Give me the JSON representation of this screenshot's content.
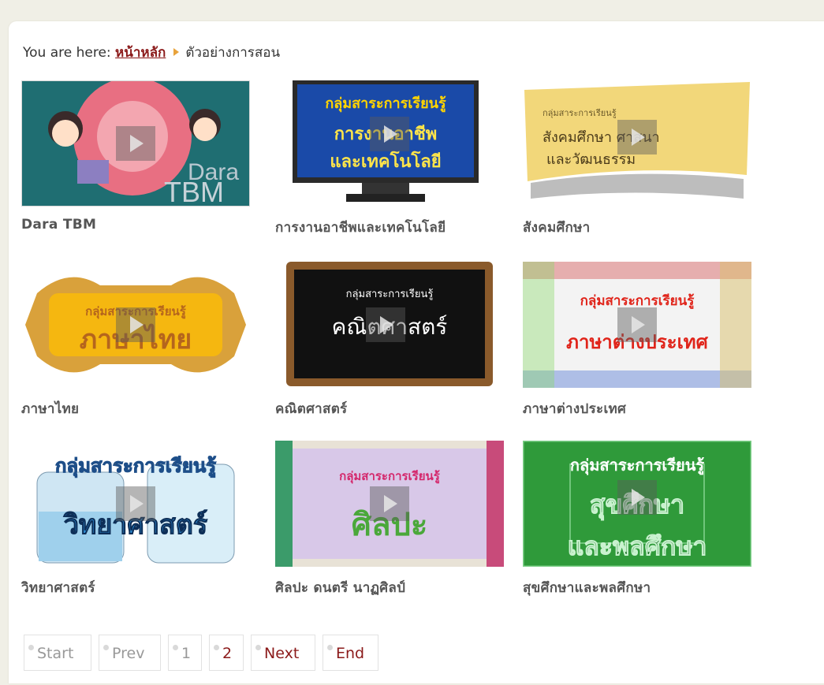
{
  "breadcrumb": {
    "prefix": "You are here: ",
    "home": "หน้าหลัก",
    "current": "ตัวอย่างการสอน"
  },
  "videos": [
    {
      "caption": "Dara TBM",
      "thumb_text": [
        "Dara",
        "TBM"
      ]
    },
    {
      "caption": "การงานอาชีพและเทคโนโลยี",
      "thumb_text": [
        "กลุ่มสาระการเรียนรู้",
        "การงานอาชีพ",
        "และเทคโนโลยี"
      ]
    },
    {
      "caption": "สังคมศึกษา",
      "thumb_text": [
        "กลุ่มสาระการเรียนรู้",
        "สังคมศึกษา ศาสนา",
        "และวัฒนธรรม"
      ]
    },
    {
      "caption": "ภาษาไทย",
      "thumb_text": [
        "กลุ่มสาระการเรียนรู้",
        "ภาษาไทย"
      ]
    },
    {
      "caption": "คณิตศาสตร์",
      "thumb_text": [
        "กลุ่มสาระการเรียนรู้",
        "คณิตศาสตร์"
      ]
    },
    {
      "caption": "ภาษาต่างประเทศ",
      "thumb_text": [
        "กลุ่มสาระการเรียนรู้",
        "ภาษาต่างประเทศ"
      ]
    },
    {
      "caption": "วิทยาศาสตร์",
      "thumb_text": [
        "กลุ่มสาระการเรียนรู้",
        "วิทยาศาสตร์"
      ]
    },
    {
      "caption": "ศิลปะ ดนตรี นาฏศิลป์",
      "thumb_text": [
        "กลุ่มสาระการเรียนรู้",
        "ศิลปะ"
      ]
    },
    {
      "caption": "สุขศึกษาและพลศึกษา",
      "thumb_text": [
        "กลุ่มสาระการเรียนรู้",
        "สุขศึกษา",
        "และพลศึกษา"
      ]
    }
  ],
  "pagination": {
    "start": "Start",
    "prev": "Prev",
    "page1": "1",
    "page2": "2",
    "next": "Next",
    "end": "End"
  },
  "colors": {
    "link": "#8b1a1a",
    "arrow": "#e8a33c",
    "caption": "#555555"
  },
  "icons": {
    "breadcrumb_separator": "triangle-right-icon",
    "video_overlay": "play-icon",
    "pager_bullet": "bullet-icon"
  }
}
